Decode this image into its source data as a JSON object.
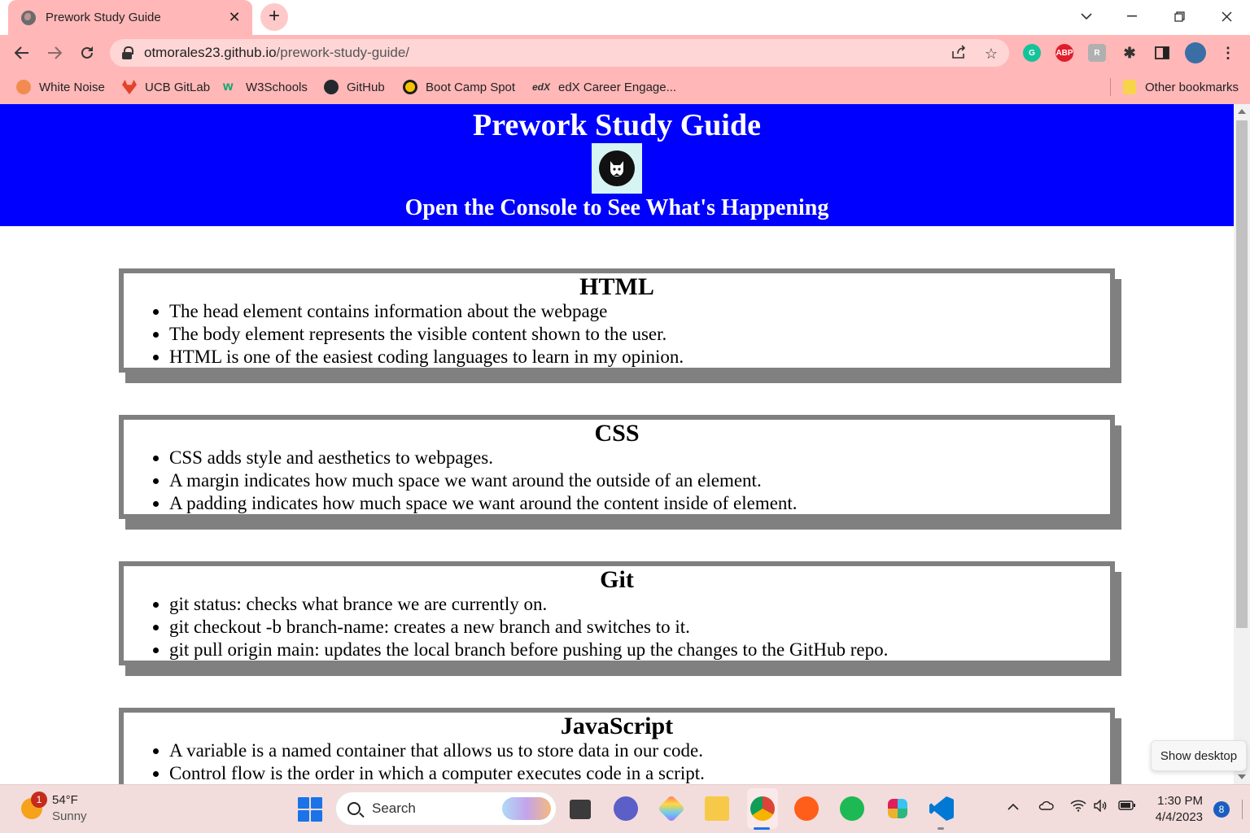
{
  "browser": {
    "tab_title": "Prework Study Guide",
    "tab_close": "✕",
    "new_tab": "+",
    "url_host": "otmorales23.github.io",
    "url_path": "/prework-study-guide/",
    "extension_abp": "ABP",
    "bookmarks": [
      {
        "label": "White Noise",
        "color": "#f28b50"
      },
      {
        "label": "UCB GitLab",
        "color": "#e24329"
      },
      {
        "label": "W3Schools",
        "color": "#04aa6d"
      },
      {
        "label": "GitHub",
        "color": "#24292f"
      },
      {
        "label": "Boot Camp Spot",
        "color": "#1c1c1c"
      },
      {
        "label": "edX Career Engage...",
        "color": "#333333"
      }
    ],
    "other_bookmarks": "Other bookmarks"
  },
  "page": {
    "title": "Prework Study Guide",
    "subtitle": "Open the Console to See What's Happening",
    "header_color": "#0000ff",
    "sections": [
      {
        "heading": "HTML",
        "items": [
          "The head element contains information about the webpage",
          "The body element represents the visible content shown to the user.",
          "HTML is one of the easiest coding languages to learn in my opinion."
        ]
      },
      {
        "heading": "CSS",
        "items": [
          "CSS adds style and aesthetics to webpages.",
          "A margin indicates how much space we want around the outside of an element.",
          "A padding indicates how much space we want around the content inside of element."
        ]
      },
      {
        "heading": "Git",
        "items": [
          "git status: checks what brance we are currently on.",
          "git checkout -b branch-name: creates a new branch and switches to it.",
          "git pull origin main: updates the local branch before pushing up the changes to the GitHub repo."
        ]
      },
      {
        "heading": "JavaScript",
        "items": [
          "A variable is a named container that allows us to store data in our code.",
          "Control flow is the order in which a computer executes code in a script."
        ]
      }
    ]
  },
  "tooltip": "Show desktop",
  "taskbar": {
    "weather_badge": "1",
    "weather_temp": "54°F",
    "weather_cond": "Sunny",
    "search_placeholder": "Search",
    "time": "1:30 PM",
    "date": "4/4/2023",
    "notifications": "8"
  }
}
